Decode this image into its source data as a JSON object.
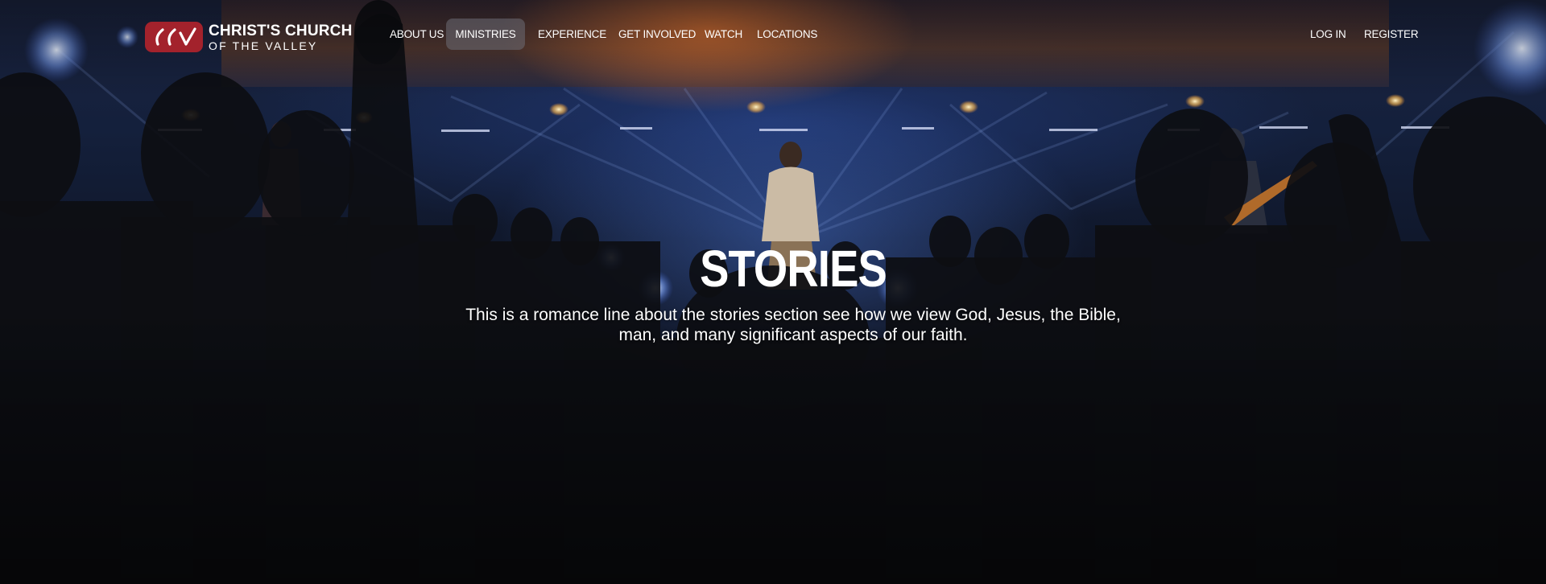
{
  "brand": {
    "line1": "CHRIST'S CHURCH",
    "line2": "OF THE VALLEY",
    "mark_color": "#a3222c",
    "icon": "ccv-logo-mark"
  },
  "nav": {
    "items": [
      {
        "label": "ABOUT US"
      },
      {
        "label": "MINISTRIES",
        "active": true
      },
      {
        "label": "EXPERIENCE"
      },
      {
        "label": "GET INVOLVED"
      },
      {
        "label": "WATCH"
      },
      {
        "label": "LOCATIONS"
      }
    ],
    "auth": {
      "login": "LOG IN",
      "register": "REGISTER"
    }
  },
  "hero": {
    "title": "STORIES",
    "description": "This is a romance line about the stories section see how we view God, Jesus, the Bible, man, and many significant aspects of our faith.",
    "background": "worship-concert-photo"
  }
}
